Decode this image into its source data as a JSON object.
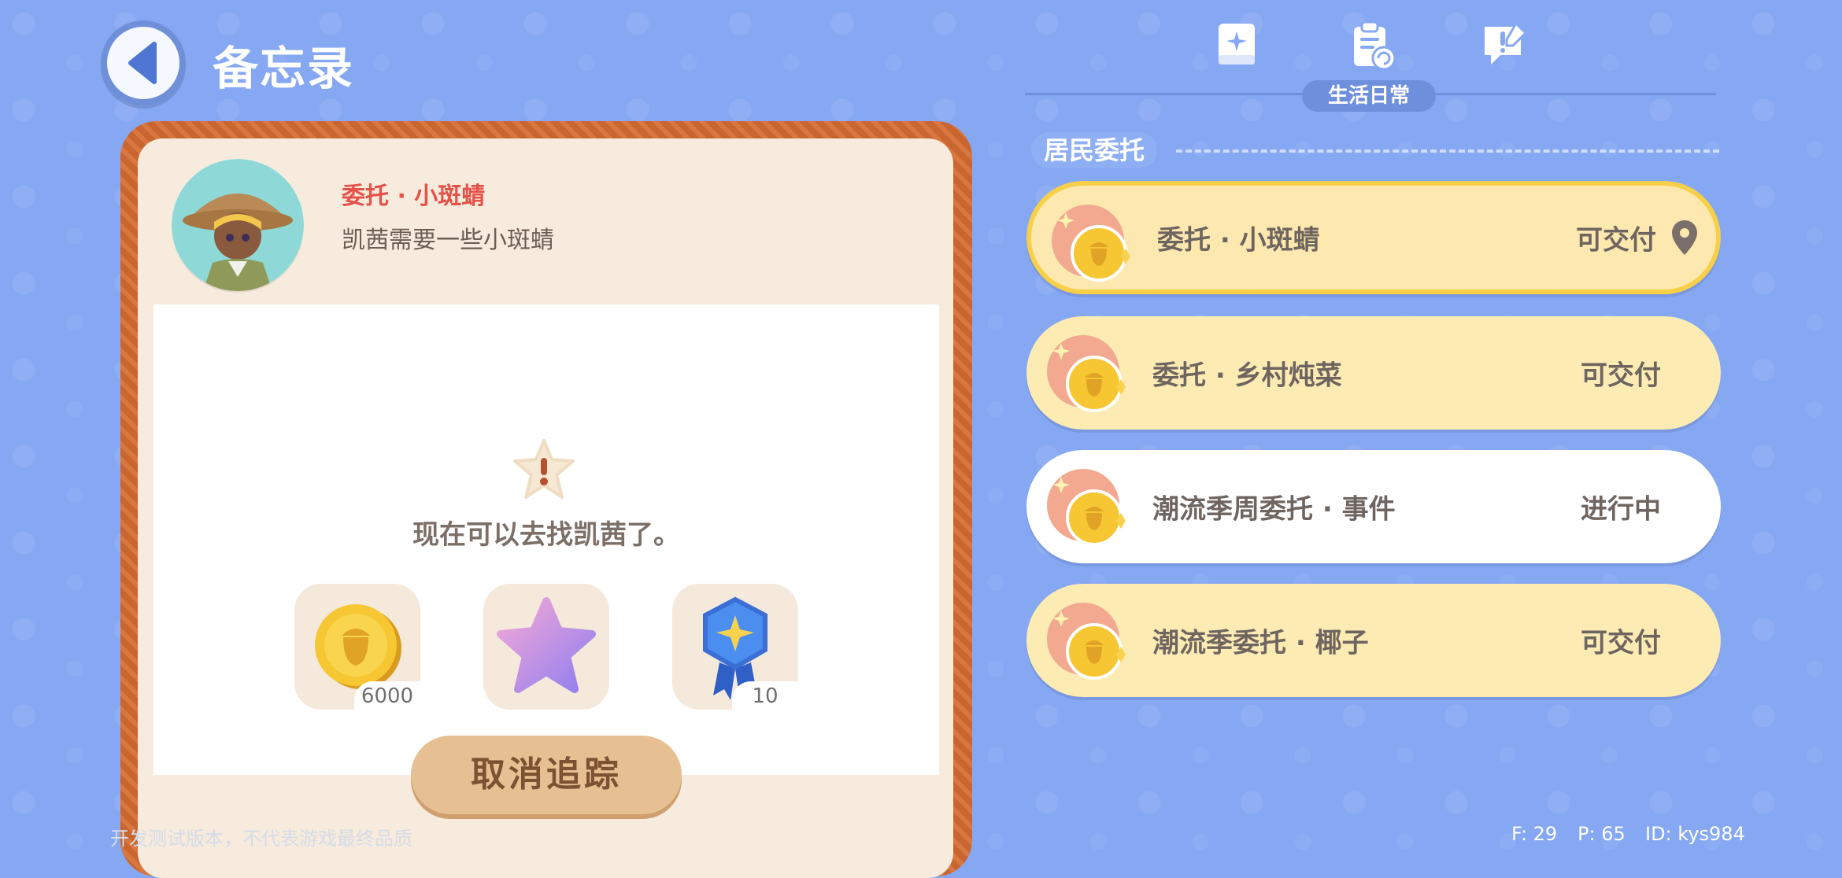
{
  "header": {
    "title": "备忘录"
  },
  "tabs": [
    {
      "icon": "book-star-icon"
    },
    {
      "icon": "clipboard-refresh-icon",
      "label": "生活日常"
    },
    {
      "icon": "chat-pen-icon"
    }
  ],
  "detail": {
    "title": "委托 · 小斑蜻",
    "description": "凯茜需要一些小斑蜻",
    "notice": "现在可以去找凯茜了。",
    "rewards": [
      {
        "icon": "acorn-coin-icon",
        "count": "6000"
      },
      {
        "icon": "purple-star-icon",
        "count": ""
      },
      {
        "icon": "badge-medal-icon",
        "count": "10"
      }
    ],
    "cancel_label": "取消追踪"
  },
  "section": {
    "title": "居民委托"
  },
  "tasks": [
    {
      "name": "委托 · 小斑蜻",
      "status": "可交付",
      "selected": true
    },
    {
      "name": "委托 · 乡村炖菜",
      "status": "可交付"
    },
    {
      "name": "潮流季周委托 · 事件",
      "status": "进行中"
    },
    {
      "name": "潮流季委托 · 椰子",
      "status": "可交付"
    }
  ],
  "footer": {
    "disclaimer": "开发测试版本，不代表游戏最终品质",
    "f": "F: 29",
    "p": "P: 65",
    "id": "ID: kys984"
  }
}
